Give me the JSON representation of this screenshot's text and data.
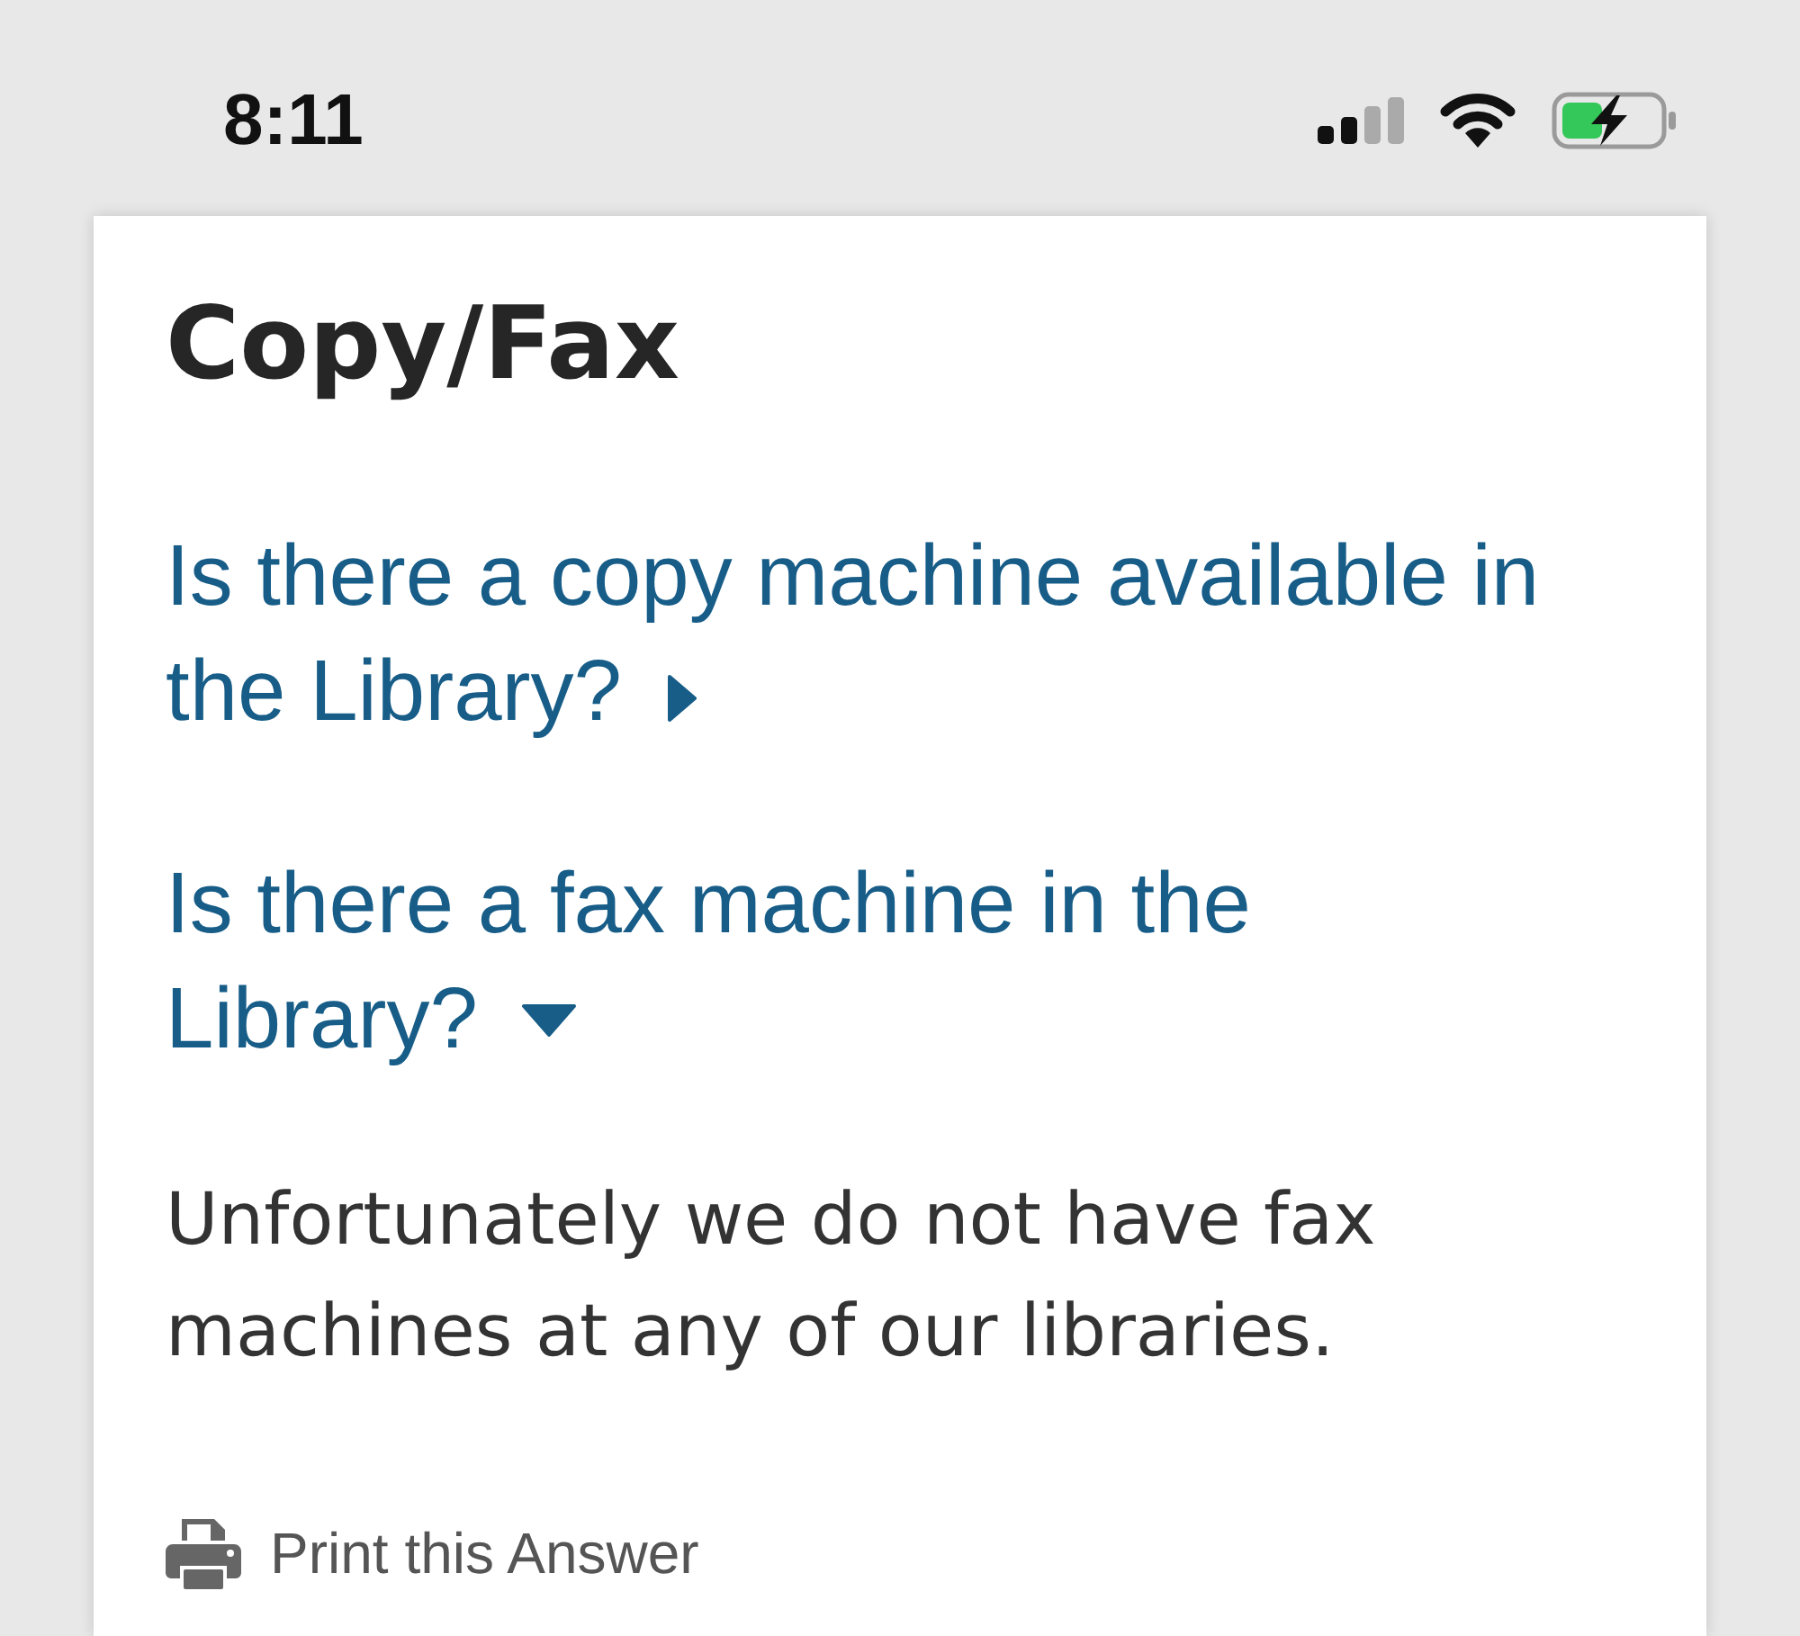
{
  "status_bar": {
    "time": "8:11"
  },
  "page": {
    "title": "Copy/Fax",
    "faqs": [
      {
        "question": "Is there a copy machine available in the Library?",
        "expanded": false
      },
      {
        "question": "Is there a fax machine in the Library?",
        "expanded": true,
        "answer": "Unfortunately we do not have fax machines at any of our libraries."
      }
    ],
    "print_link": "Print this Answer"
  }
}
